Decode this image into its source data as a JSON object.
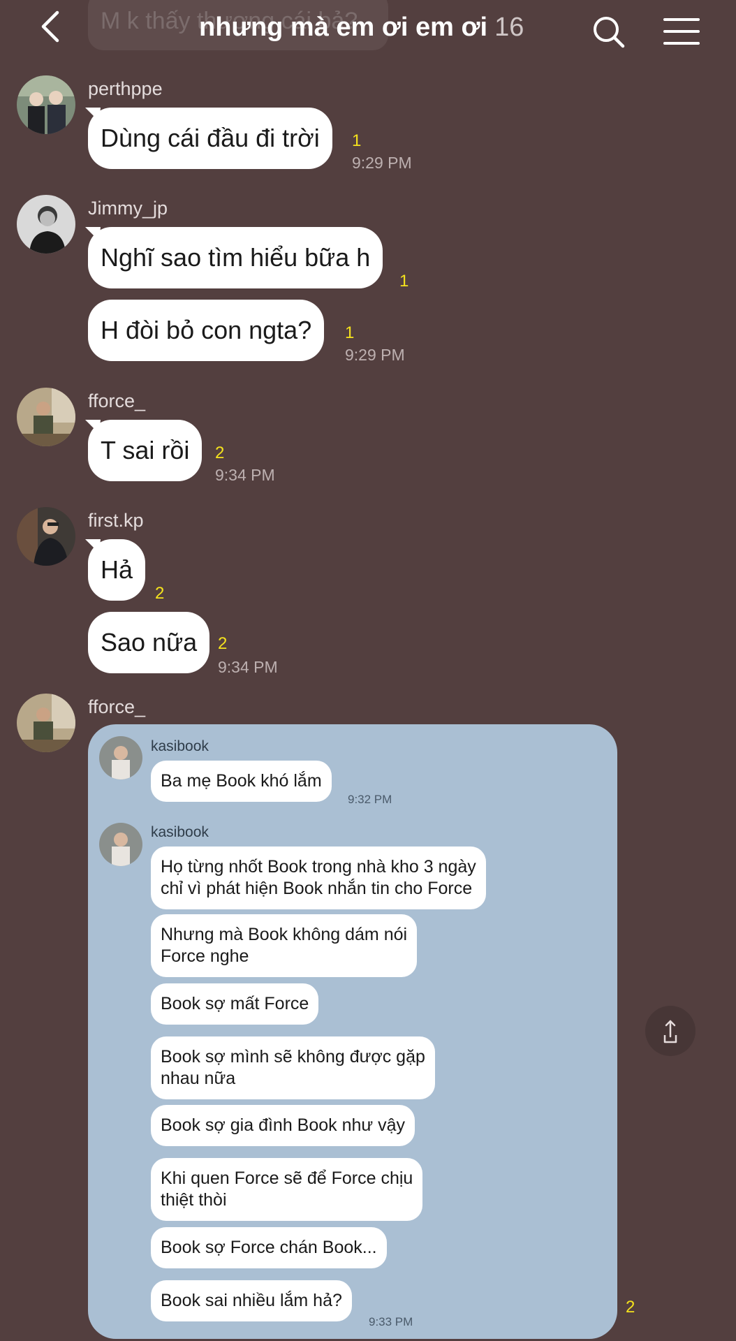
{
  "header": {
    "ghost_text": "M k thấy thương cái bả?",
    "title": "nhưng mà em ơi em ơi",
    "member_count": "16",
    "back_icon": "chevron-left-icon",
    "search_icon": "search-icon",
    "menu_icon": "hamburger-menu-icon"
  },
  "messages": [
    {
      "user": "perthppe",
      "bubbles": [
        {
          "text": "Dùng cái đầu đi trời",
          "unread": "1",
          "time": "9:29 PM"
        }
      ]
    },
    {
      "user": "Jimmy_jp",
      "bubbles": [
        {
          "text": "Nghĩ sao tìm hiểu bữa h",
          "unread": "1",
          "time": ""
        },
        {
          "text": "H đòi bỏ con ngta?",
          "unread": "1",
          "time": "9:29 PM"
        }
      ]
    },
    {
      "user": "fforce_",
      "bubbles": [
        {
          "text": "T sai rồi",
          "unread": "2",
          "time": "9:34 PM"
        }
      ]
    },
    {
      "user": "first.kp",
      "bubbles": [
        {
          "text": "Hả",
          "unread": "2",
          "time": ""
        },
        {
          "text": "Sao nữa",
          "unread": "2",
          "time": "9:34 PM"
        }
      ]
    },
    {
      "user": "fforce_",
      "unread": "2"
    }
  ],
  "forwarded": {
    "groups": [
      {
        "user": "kasibook",
        "bubbles": [
          {
            "text": "Ba mẹ Book khó lắm",
            "time": "9:32 PM"
          }
        ]
      },
      {
        "user": "kasibook",
        "bubbles": [
          {
            "line1": "Họ từng nhốt Book trong nhà kho 3 ngày",
            "line2": "chỉ vì phát hiện Book nhắn tin cho Force"
          },
          {
            "line1": "Nhưng mà Book không dám nói",
            "line2": "Force nghe"
          },
          {
            "line1": "Book sợ mất Force",
            "line2": ""
          },
          {
            "line1": "Book sợ mình sẽ không được gặp",
            "line2": "nhau nữa"
          },
          {
            "line1": "Book sợ gia đình Book như vậy",
            "line2": ""
          },
          {
            "line1": "Khi quen Force sẽ để Force chịu",
            "line2": "thiệt thòi"
          },
          {
            "line1": "Book sợ Force chán Book...",
            "line2": ""
          },
          {
            "line1": "Book sai nhiều lắm hả?",
            "line2": "",
            "time": "9:33 PM"
          }
        ]
      }
    ]
  },
  "share_icon": "share-icon",
  "colors": {
    "background": "#533f3f",
    "unread": "#f4e21d",
    "forward_card": "#aabfd3"
  }
}
